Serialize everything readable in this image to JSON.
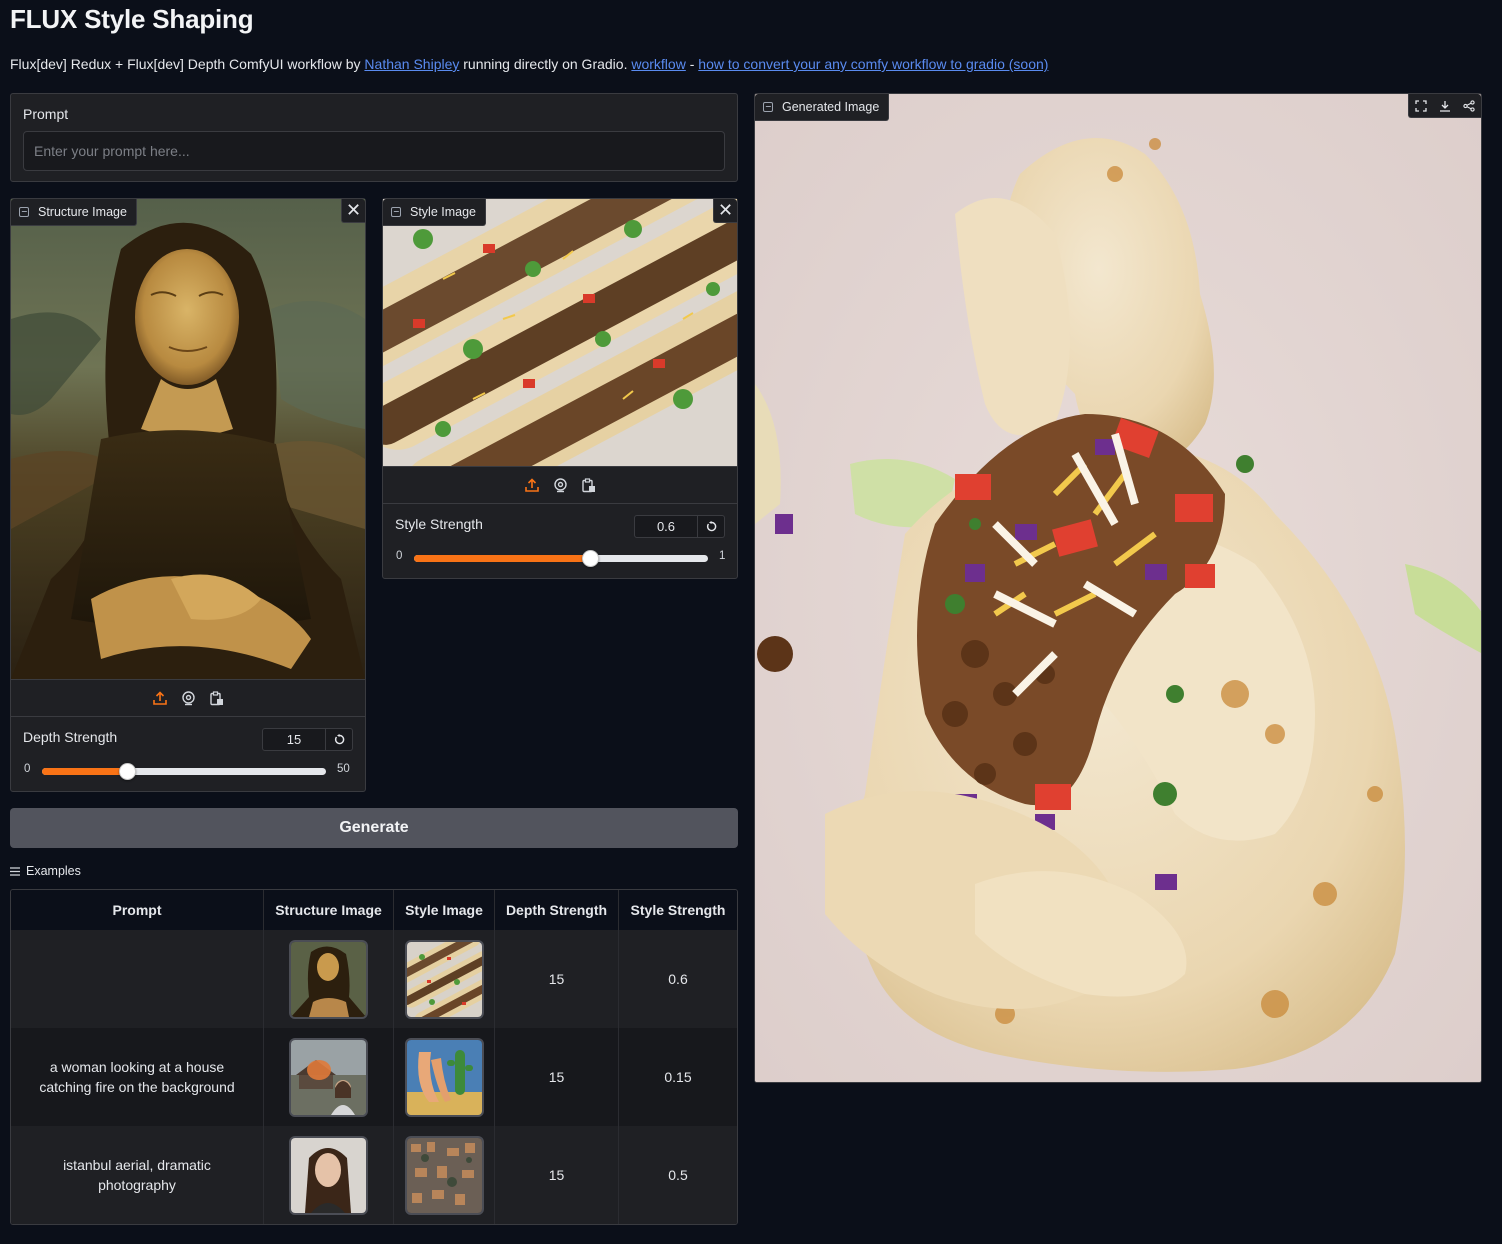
{
  "page": {
    "title": "FLUX Style Shaping",
    "description": {
      "lead": "Flux[dev] Redux + Flux[dev] Depth ComfyUI workflow by ",
      "author_link": "Nathan Shipley",
      "middle": " running directly on Gradio. ",
      "workflow_link": "workflow",
      "dash": " - ",
      "convert_link": "how to convert your any comfy workflow to gradio (soon)"
    }
  },
  "prompt": {
    "label": "Prompt",
    "placeholder": "Enter your prompt here...",
    "value": ""
  },
  "structure": {
    "label": "Structure Image",
    "close": "✕",
    "slider": {
      "label": "Depth Strength",
      "value": "15",
      "min": "0",
      "max": "50",
      "fraction": 0.3
    }
  },
  "style": {
    "label": "Style Image",
    "close": "✕",
    "slider": {
      "label": "Style Strength",
      "value": "0.6",
      "min": "0",
      "max": "1",
      "fraction": 0.6
    }
  },
  "generate_label": "Generate",
  "examples": {
    "label": "Examples",
    "headers": [
      "Prompt",
      "Structure Image",
      "Style Image",
      "Depth Strength",
      "Style Strength"
    ],
    "rows": [
      {
        "prompt": "",
        "depth": "15",
        "style": "0.6"
      },
      {
        "prompt": "a woman looking at a house catching fire on the background",
        "depth": "15",
        "style": "0.15"
      },
      {
        "prompt": "istanbul aerial, dramatic photography",
        "depth": "15",
        "style": "0.5"
      }
    ]
  },
  "output": {
    "label": "Generated Image"
  },
  "colors": {
    "accent": "#f97316",
    "link": "#5a8bf0",
    "background": "#0b0f19",
    "panel": "#1f2024"
  },
  "icons": [
    "image-icon",
    "close-icon",
    "upload-icon",
    "webcam-icon",
    "clipboard-icon",
    "reset-icon",
    "fullscreen-icon",
    "download-icon",
    "share-icon",
    "list-icon"
  ]
}
